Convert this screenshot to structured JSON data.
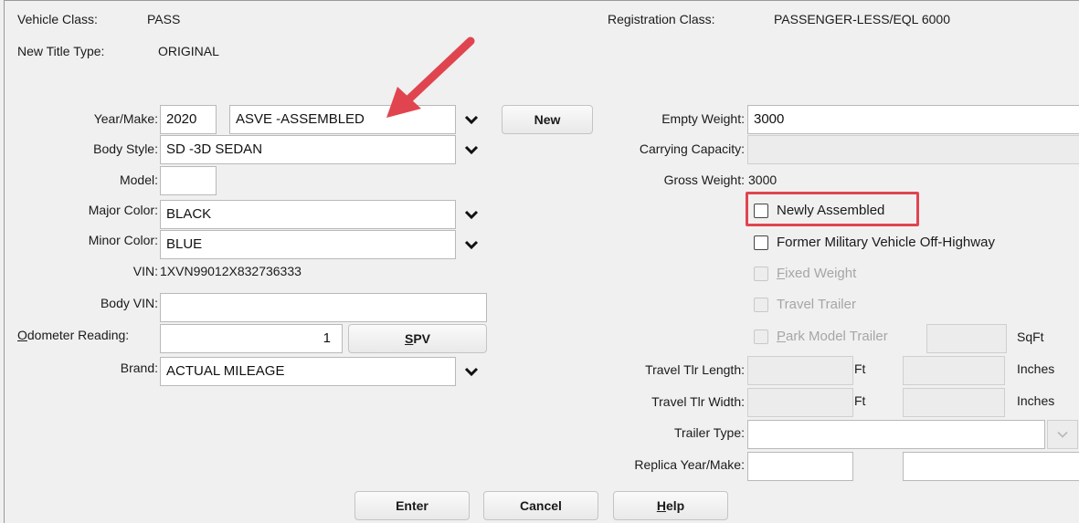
{
  "header": {
    "vehicle_class_label": "Vehicle Class:",
    "vehicle_class_value": "PASS",
    "new_title_type_label": "New Title Type:",
    "new_title_type_value": "ORIGINAL",
    "registration_class_label": "Registration Class:",
    "registration_class_value": "PASSENGER-LESS/EQL 6000"
  },
  "left": {
    "year_make_label": "Year/Make:",
    "year_value": "2020",
    "make_value": "ASVE -ASSEMBLED",
    "new_button": "New",
    "body_style_label": "Body Style:",
    "body_style_value": "SD -3D SEDAN",
    "model_label": "Model:",
    "model_value": "",
    "major_color_label": "Major Color:",
    "major_color_value": "BLACK",
    "minor_color_label": "Minor Color:",
    "minor_color_value": "BLUE",
    "vin_label": "VIN:",
    "vin_value": "1XVN99012X832736333",
    "body_vin_label": "Body VIN:",
    "body_vin_value": "",
    "odometer_label_first": "O",
    "odometer_label_rest": "dometer Reading:",
    "odometer_value": "1",
    "spv_button_first": "S",
    "spv_button_rest": "PV",
    "brand_label": "Brand:",
    "brand_value": "ACTUAL MILEAGE"
  },
  "right": {
    "empty_weight_label": "Empty Weight:",
    "empty_weight_value": "3000",
    "carrying_capacity_label": "Carrying Capacity:",
    "carrying_capacity_value": "",
    "gross_weight_label": "Gross Weight:",
    "gross_weight_value": "3000",
    "newly_assembled_label": "Newly Assembled",
    "former_military_label": "Former Military Vehicle Off-Highway",
    "fixed_weight_first": "F",
    "fixed_weight_rest": "ixed Weight",
    "travel_trailer_label": "Travel Trailer",
    "park_model_first": "P",
    "park_model_rest": "ark Model Trailer",
    "sqft_label": "SqFt",
    "travel_tlr_length_label": "Travel Tlr Length:",
    "travel_tlr_width_label": "Travel Tlr Width:",
    "ft_label": "Ft",
    "inches_label": "Inches",
    "trailer_type_label": "Trailer Type:",
    "trailer_type_value": "",
    "replica_label": "Replica Year/Make:"
  },
  "footer": {
    "enter_button": "Enter",
    "cancel_button": "Cancel",
    "help_first": "H",
    "help_rest": "elp"
  },
  "colors": {
    "annotation_red": "#e0454f",
    "background": "#f0f0f0"
  },
  "icons": {
    "dropdown": "chevron-down-icon",
    "annotation": "arrow-annotation-icon"
  }
}
